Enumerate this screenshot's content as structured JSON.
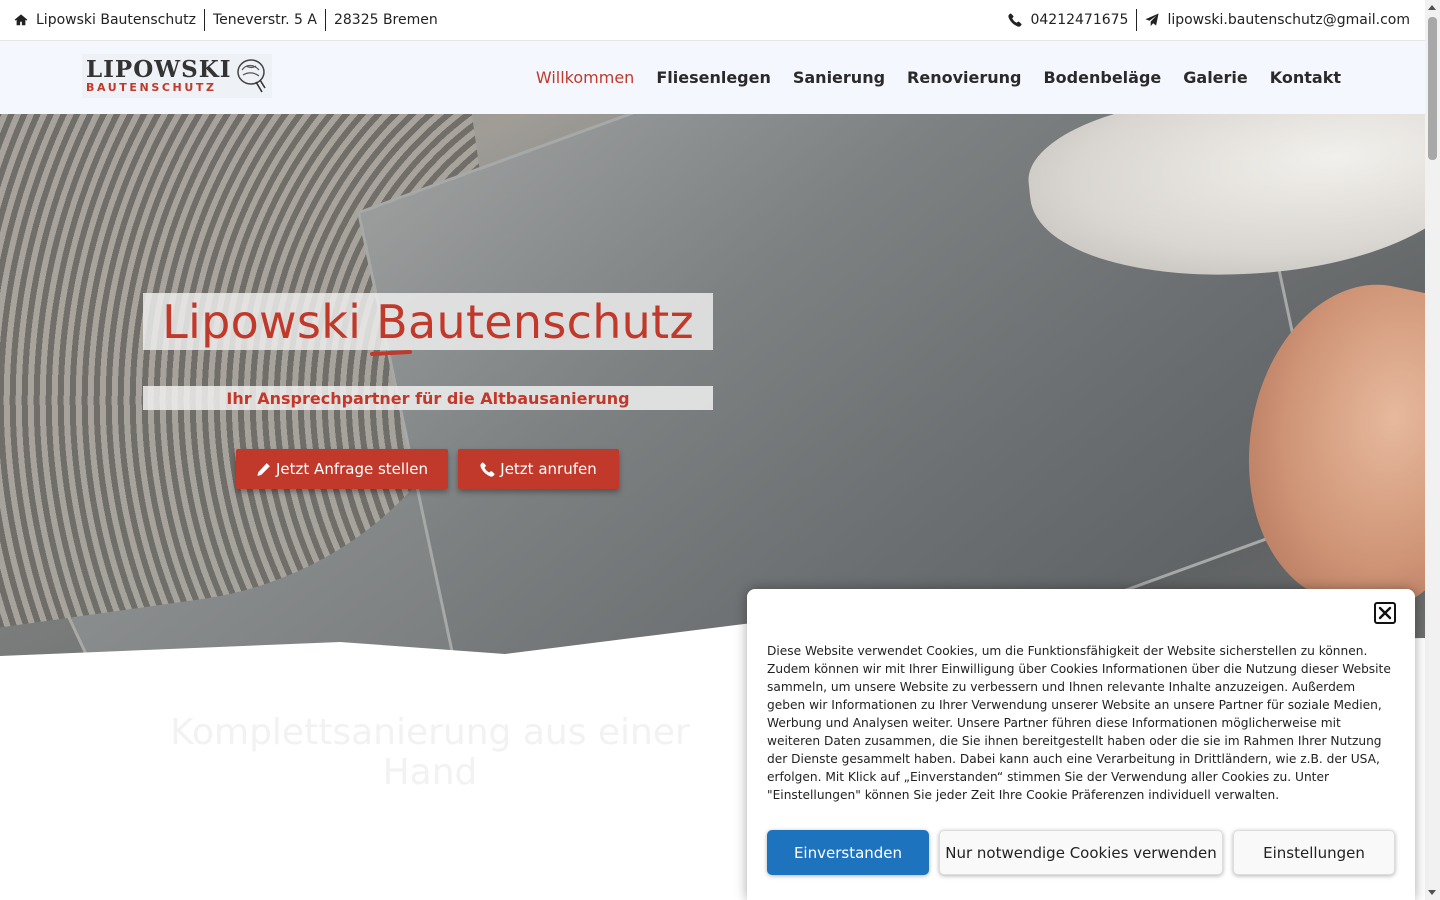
{
  "topbar": {
    "company": "Lipowski Bautenschutz",
    "street": "Teneverstr. 5 A",
    "city": "28325 Bremen",
    "phone": "04212471675",
    "email": "lipowski.bautenschutz@gmail.com"
  },
  "header": {
    "logo_name": "LIPOWSKI",
    "logo_sub": "BAUTENSCHUTZ",
    "nav": [
      {
        "label": "Willkommen",
        "active": true
      },
      {
        "label": "Fliesenlegen",
        "active": false
      },
      {
        "label": "Sanierung",
        "active": false
      },
      {
        "label": "Renovierung",
        "active": false
      },
      {
        "label": "Bodenbeläge",
        "active": false
      },
      {
        "label": "Galerie",
        "active": false
      },
      {
        "label": "Kontakt",
        "active": false
      }
    ]
  },
  "hero": {
    "title": "Lipowski Bautenschutz",
    "subtitle": "Ihr Ansprechpartner für die Altbausanierung",
    "btn_request": "Jetzt Anfrage stellen",
    "btn_call": "Jetzt anrufen"
  },
  "content": {
    "title": "Komplettsanierung aus einer Hand"
  },
  "cookie": {
    "text": "Diese Website verwendet Cookies, um die Funktionsfähigkeit der Website sicherstellen zu können. Zudem können wir mit Ihrer Einwilligung über Cookies Informationen über die Nutzung dieser Website sammeln, um unsere Website zu verbessern und Ihnen relevante Inhalte anzuzeigen. Außerdem geben wir Informationen zu Ihrer Verwendung unserer Website an unsere Partner für soziale Medien, Werbung und Analysen weiter. Unsere Partner führen diese Informationen möglicherweise mit weiteren Daten zusammen, die Sie ihnen bereitgestellt haben oder die sie im Rahmen Ihrer Nutzung der Dienste gesammelt haben. Dabei kann auch eine Verarbeitung in Drittländern, wie z.B. der USA, erfolgen. Mit Klick auf „Einverstanden“ stimmen Sie der Verwendung aller Cookies zu. Unter \"Einstellungen\" können Sie jeder Zeit Ihre Cookie Präferenzen individuell verwalten.",
    "btn_accept": "Einverstanden",
    "btn_necessary": "Nur notwendige Cookies verwenden",
    "btn_settings": "Einstellungen"
  },
  "colors": {
    "accent": "#c0392b",
    "cookie_primary": "#1e73be",
    "header_bg": "#f4f7fd"
  },
  "icons": [
    "home-icon",
    "phone-icon",
    "paper-plane-icon",
    "pencil-icon",
    "close-icon"
  ]
}
